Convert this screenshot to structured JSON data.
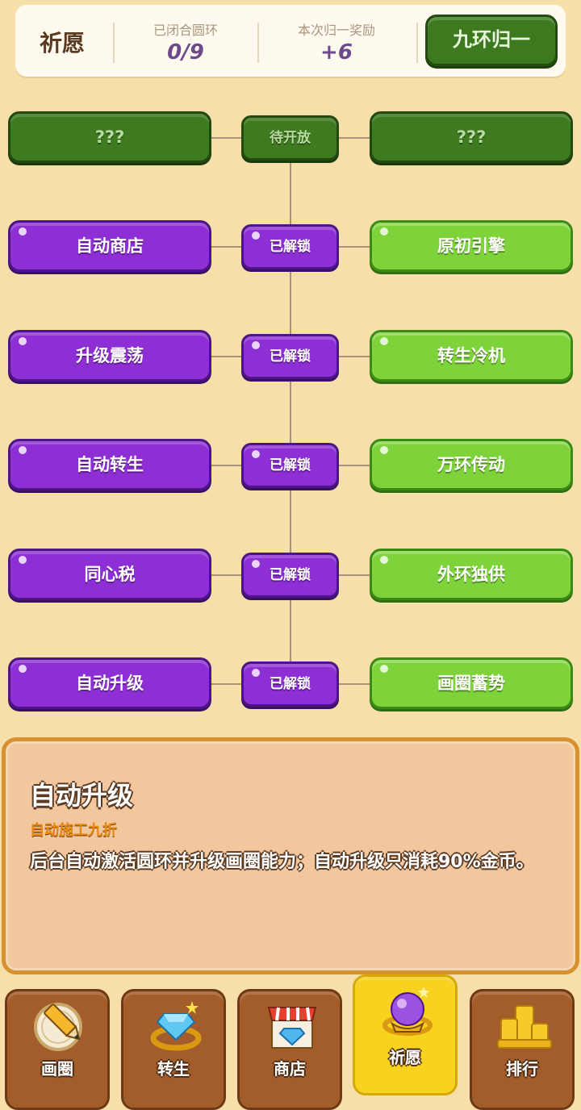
{
  "header": {
    "title": "祈愿",
    "closed_rings_label": "已闭合圆环",
    "closed_rings_value": "0/9",
    "reward_label": "本次归一奖励",
    "reward_value": "+6",
    "action_button": "九环归一"
  },
  "tree": {
    "rows": [
      {
        "left": "???",
        "center": "待开放",
        "right": "???",
        "state": "locked"
      },
      {
        "left": "自动商店",
        "center": "已解锁",
        "right": "原初引擎",
        "state": "unlocked"
      },
      {
        "left": "升级震荡",
        "center": "已解锁",
        "right": "转生冷机",
        "state": "unlocked"
      },
      {
        "left": "自动转生",
        "center": "已解锁",
        "right": "万环传动",
        "state": "unlocked"
      },
      {
        "left": "同心税",
        "center": "已解锁",
        "right": "外环独供",
        "state": "unlocked"
      },
      {
        "left": "自动升级",
        "center": "已解锁",
        "right": "画圈蓄势",
        "state": "unlocked"
      }
    ]
  },
  "detail": {
    "title": "自动升级",
    "subtitle": "自动施工九折",
    "description": "后台自动激活圆环并升级画圈能力；自动升级只消耗90%金币。"
  },
  "nav": {
    "items": [
      {
        "label": "画圈",
        "icon": "pencil-icon"
      },
      {
        "label": "转生",
        "icon": "diamond-ring-icon"
      },
      {
        "label": "商店",
        "icon": "shop-icon"
      },
      {
        "label": "祈愿",
        "icon": "crystal-ball-icon"
      },
      {
        "label": "排行",
        "icon": "podium-icon"
      }
    ],
    "active": "祈愿"
  },
  "colors": {
    "background": "#f7dfa9",
    "purple": "#8d2fd4",
    "green": "#7ed33a",
    "dark_green": "#3e7a1f",
    "nav_brown": "#a35d2a",
    "nav_active": "#f7d21f"
  }
}
